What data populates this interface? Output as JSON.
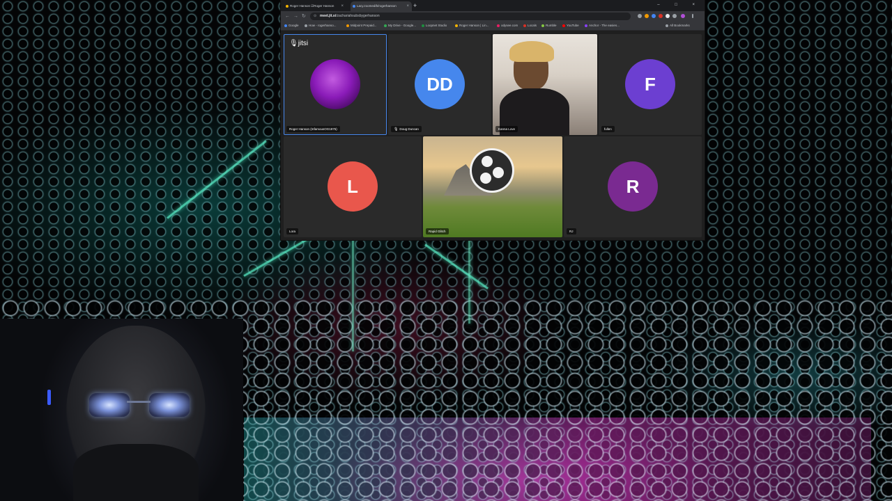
{
  "browser": {
    "tabs": [
      {
        "label": "Roger Hanson ☑Roger Hanson",
        "active": false,
        "favicon_color": "#f5b400"
      },
      {
        "label": "Lacy.zoomed/b/rogerhanson",
        "active": true,
        "favicon_color": "#4687ed"
      }
    ],
    "window_controls": "– □ ×",
    "url_domain": "meet.jit.si",
    "url_path": "/zachariahsubsbygerhanson",
    "bookmarks": [
      {
        "label": "Google",
        "color": "#4285f4"
      },
      {
        "label": "How - rogerhanso...",
        "color": "#9aa0a6"
      },
      {
        "label": "Midpoint Prepaid...",
        "color": "#f29900"
      },
      {
        "label": "My Drive - Google...",
        "color": "#34a853"
      },
      {
        "label": "Loopnet Studio",
        "color": "#1e8e3e"
      },
      {
        "label": "Roger Hanson | Lin...",
        "color": "#f5b400"
      },
      {
        "label": "odysee.com",
        "color": "#e91e63"
      },
      {
        "label": "Locals",
        "color": "#d93025"
      },
      {
        "label": "Rumble",
        "color": "#85c742"
      },
      {
        "label": "YouTube",
        "color": "#ff0000"
      },
      {
        "label": "Anchor - The easies...",
        "color": "#8940fa"
      }
    ],
    "all_bookmarks": "All Bookmarks"
  },
  "meeting": {
    "logo": "jitsi",
    "participants": [
      {
        "name": "Roger Hanson (InfamousOG1975)",
        "type": "video-purple",
        "active": true
      },
      {
        "name": "Doug Duncan",
        "type": "avatar",
        "initials": "DD",
        "color": "#4687ed"
      },
      {
        "name": "Kanna Love",
        "type": "video-person"
      },
      {
        "name": "fullen",
        "type": "avatar",
        "initials": "F",
        "color": "#6c3fd1"
      },
      {
        "name": "Lora",
        "type": "avatar",
        "initials": "L",
        "color": "#e9574c"
      },
      {
        "name": "Rapid Glitch",
        "type": "video-obs"
      },
      {
        "name": "RJ",
        "type": "avatar",
        "initials": "R",
        "color": "#7a2a91"
      }
    ]
  }
}
